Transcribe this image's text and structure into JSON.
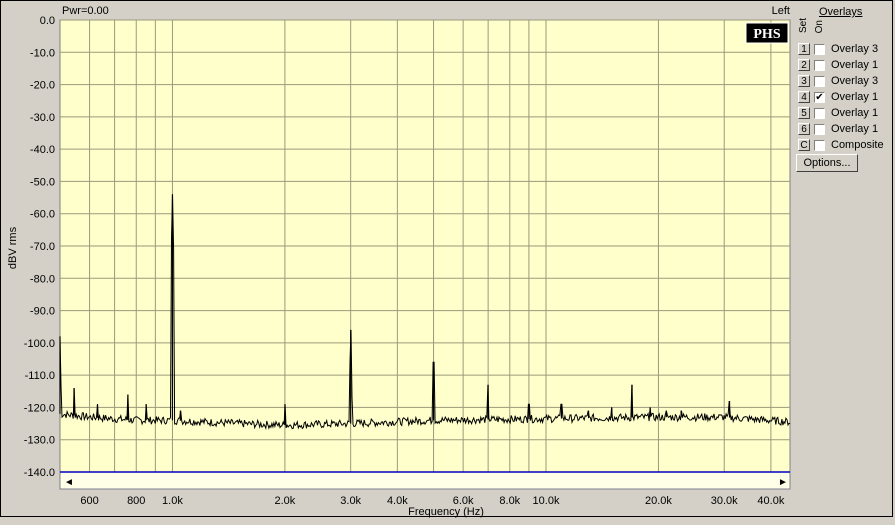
{
  "header": {
    "power_label": "Pwr=0.00",
    "channel": "Left",
    "logo_text": "PHS"
  },
  "overlays": {
    "title": "Overlays",
    "set_header": "Set",
    "on_header": "On",
    "rows": [
      {
        "num": "1",
        "label": "Overlay 3",
        "checked": false
      },
      {
        "num": "2",
        "label": "Overlay 1",
        "checked": false
      },
      {
        "num": "3",
        "label": "Overlay 3",
        "checked": false
      },
      {
        "num": "4",
        "label": "Overlay 1",
        "checked": true
      },
      {
        "num": "5",
        "label": "Overlay 1",
        "checked": false
      },
      {
        "num": "6",
        "label": "Overlay 1",
        "checked": false
      },
      {
        "num": "C",
        "label": "Composite",
        "checked": false
      }
    ],
    "options_label": "Options..."
  },
  "chart_data": {
    "type": "line",
    "xlabel": "Frequency (Hz)",
    "ylabel": "dBV rms",
    "x_scale": "log",
    "xlim": [
      500,
      45000
    ],
    "ylim": [
      -140,
      0
    ],
    "y_ticks": [
      0,
      -10,
      -20,
      -30,
      -40,
      -50,
      -60,
      -70,
      -80,
      -90,
      -100,
      -110,
      -120,
      -130,
      -140
    ],
    "y_tick_labels": [
      "0.0",
      "-10.0",
      "-20.0",
      "-30.0",
      "-40.0",
      "-50.0",
      "-60.0",
      "-70.0",
      "-80.0",
      "-90.0",
      "-100.0",
      "-110.0",
      "-120.0",
      "-130.0",
      "-140.0"
    ],
    "x_ticks": [
      600,
      800,
      1000,
      2000,
      3000,
      4000,
      6000,
      8000,
      10000,
      20000,
      30000,
      40000
    ],
    "x_tick_labels": [
      "600",
      "800",
      "1.0k",
      "2.0k",
      "3.0k",
      "4.0k",
      "6.0k",
      "8.0k",
      "10.0k",
      "20.0k",
      "30.0k",
      "40.0k"
    ],
    "x_grid": [
      600,
      700,
      800,
      900,
      1000,
      2000,
      3000,
      4000,
      5000,
      6000,
      7000,
      8000,
      9000,
      10000,
      20000,
      30000,
      40000
    ],
    "grid": true,
    "background": "#ffffcc",
    "line_color": "#000000",
    "noise_floor": [
      [
        500,
        -122
      ],
      [
        600,
        -123
      ],
      [
        800,
        -124
      ],
      [
        1000,
        -124
      ],
      [
        1500,
        -125
      ],
      [
        2000,
        -125.5
      ],
      [
        3000,
        -125
      ],
      [
        5000,
        -124
      ],
      [
        10000,
        -123.5
      ],
      [
        20000,
        -123
      ],
      [
        30000,
        -123
      ],
      [
        45000,
        -124.5
      ]
    ],
    "peaks": [
      {
        "x": 500,
        "y": -98
      },
      {
        "x": 545,
        "y": -114
      },
      {
        "x": 630,
        "y": -119
      },
      {
        "x": 760,
        "y": -116
      },
      {
        "x": 850,
        "y": -119
      },
      {
        "x": 1000,
        "y": -54
      },
      {
        "x": 1050,
        "y": -121
      },
      {
        "x": 2000,
        "y": -119
      },
      {
        "x": 3000,
        "y": -96
      },
      {
        "x": 5000,
        "y": -106
      },
      {
        "x": 7000,
        "y": -113
      },
      {
        "x": 9000,
        "y": -119
      },
      {
        "x": 11000,
        "y": -119
      },
      {
        "x": 13000,
        "y": -121
      },
      {
        "x": 15000,
        "y": -120
      },
      {
        "x": 17000,
        "y": -113
      },
      {
        "x": 19000,
        "y": -120
      },
      {
        "x": 21000,
        "y": -121
      },
      {
        "x": 23000,
        "y": -121
      },
      {
        "x": 31000,
        "y": -118
      }
    ]
  }
}
